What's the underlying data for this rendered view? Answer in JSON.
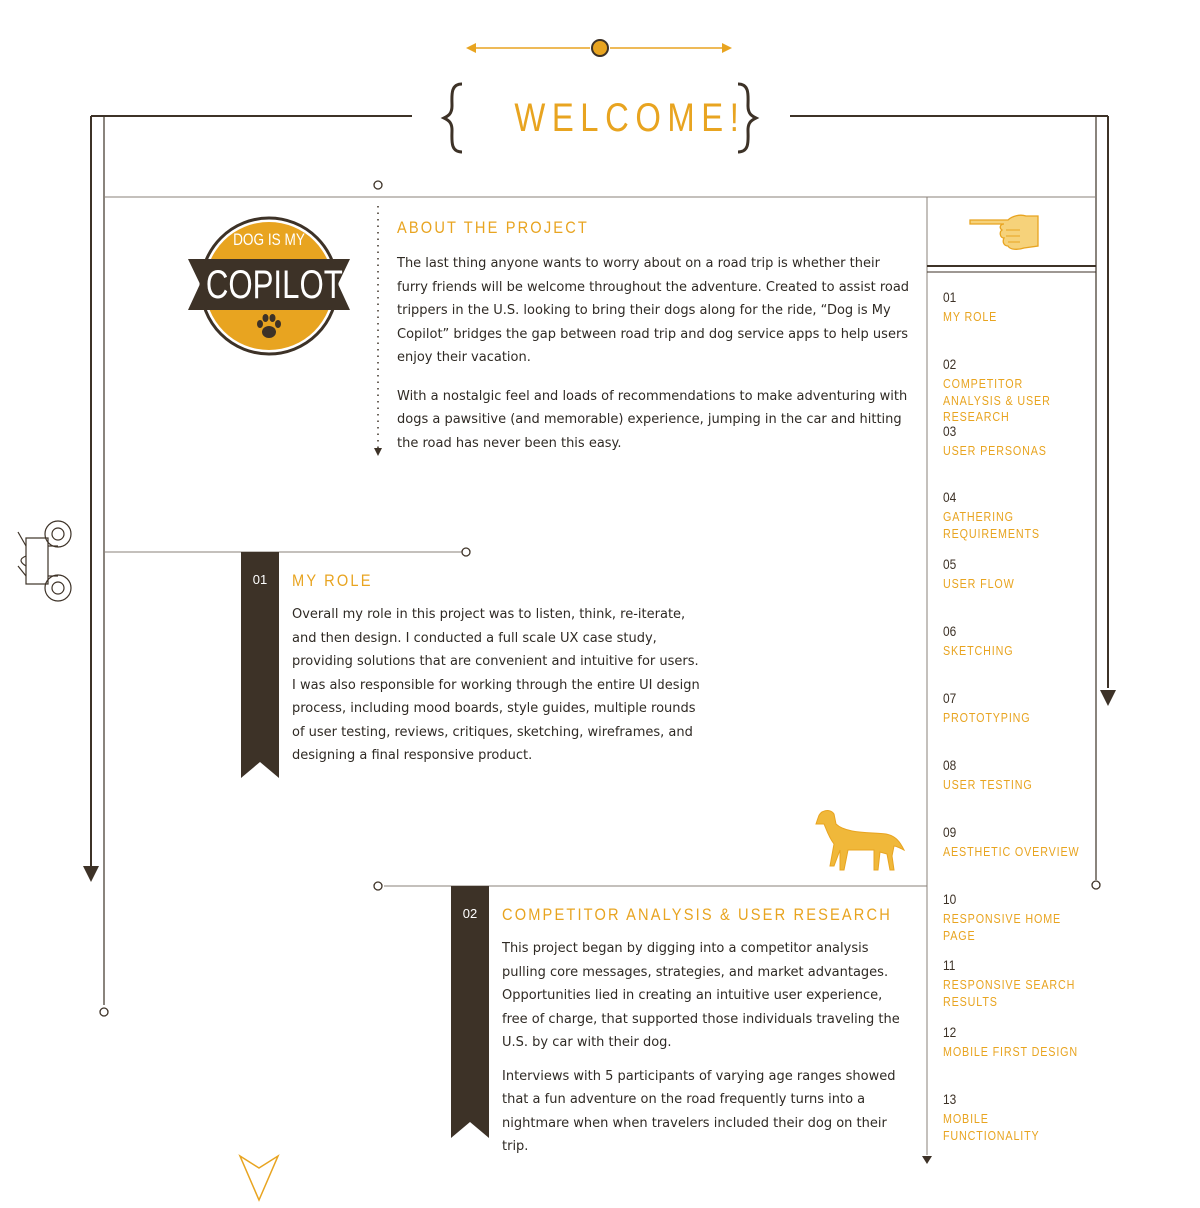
{
  "header": {
    "title": "WELCOME!"
  },
  "logo": {
    "line1": "DOG IS MY",
    "line2": "COPILOT",
    "badge_icon": "paw-icon"
  },
  "about": {
    "heading": "ABOUT THE PROJECT",
    "paragraphs": [
      "The last thing anyone wants to worry about on a road trip is whether their furry friends will be welcome throughout the adventure. Created to assist road trippers in the U.S. looking to bring their dogs along for the ride, “Dog is My Copilot” bridges the gap between road trip and dog service apps to help users enjoy their vacation.",
      "With a nostalgic feel and loads of recommendations to make adventuring with dogs a pawsitive (and memorable) experience, jumping in the car and hitting the road has never been this easy."
    ]
  },
  "sections": [
    {
      "number": "01",
      "heading": "MY ROLE",
      "paragraphs": [
        "Overall my role in this project was to listen, think, re-iterate, and then design. I conducted a full scale UX case study, providing solutions that are convenient and intuitive for users. I was also responsible for working through the entire UI design process, including mood boards, style guides, multiple rounds of user testing, reviews, critiques, sketching, wireframes, and designing a final responsive product."
      ]
    },
    {
      "number": "02",
      "heading": "COMPETITOR ANALYSIS & USER RESEARCH",
      "paragraphs": [
        "This project began by digging into a competitor analysis pulling core messages, strategies, and market advantages. Opportunities lied in creating an intuitive user experience, free of charge, that supported those individuals traveling the U.S. by car with their dog.",
        "Interviews with 5 participants of varying age ranges showed that a fun adventure on the road frequently turns into a nightmare when when travelers included their dog on their trip."
      ]
    }
  ],
  "nav": {
    "icon": "pointing-hand-icon",
    "items": [
      {
        "number": "01",
        "label": "MY ROLE"
      },
      {
        "number": "02",
        "label": "COMPETITOR ANALYSIS & USER RESEARCH"
      },
      {
        "number": "03",
        "label": "USER PERSONAS"
      },
      {
        "number": "04",
        "label": "GATHERING REQUIREMENTS"
      },
      {
        "number": "05",
        "label": "USER FLOW"
      },
      {
        "number": "06",
        "label": "SKETCHING"
      },
      {
        "number": "07",
        "label": "PROTOTYPING"
      },
      {
        "number": "08",
        "label": "USER TESTING"
      },
      {
        "number": "09",
        "label": "AESTHETIC OVERVIEW"
      },
      {
        "number": "10",
        "label": "RESPONSIVE HOME PAGE"
      },
      {
        "number": "11",
        "label": "RESPONSIVE SEARCH RESULTS"
      },
      {
        "number": "12",
        "label": "MOBILE FIRST DESIGN"
      },
      {
        "number": "13",
        "label": "MOBILE FUNCTIONALITY"
      }
    ]
  },
  "illustrations": [
    "vintage-car-icon",
    "dog-icon",
    "down-chevron-icon"
  ],
  "colors": {
    "accent": "#e8a420",
    "dark": "#3d3227",
    "line": "#8a8178"
  }
}
